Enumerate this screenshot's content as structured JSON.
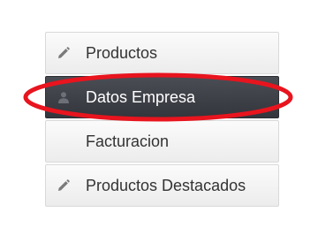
{
  "menu": {
    "items": [
      {
        "label": "Productos",
        "icon": "pencil-icon",
        "active": false
      },
      {
        "label": "Datos Empresa",
        "icon": "user-icon",
        "active": true
      },
      {
        "label": "Facturacion",
        "icon": "",
        "active": false
      },
      {
        "label": "Productos Destacados",
        "icon": "pencil-icon",
        "active": false
      }
    ],
    "active_background": "#3a3d43",
    "highlight_color": "#e8141e"
  }
}
